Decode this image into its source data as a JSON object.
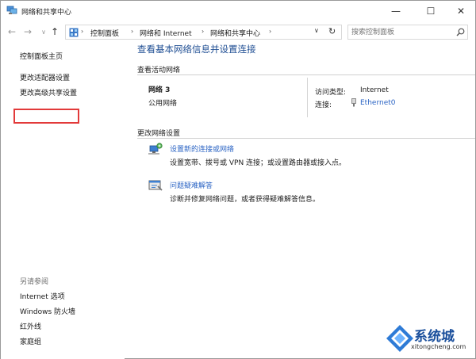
{
  "window": {
    "title": "网络和共享中心",
    "controls": {
      "minimize": "—",
      "maximize": "☐",
      "close": "✕"
    }
  },
  "navbar": {
    "back": "←",
    "forward": "→",
    "recent": "∨",
    "up": "↑",
    "breadcrumb": [
      "控制面板",
      "网络和 Internet",
      "网络和共享中心"
    ],
    "separator": "›",
    "dropdown": "∨",
    "refresh": "↻",
    "search_placeholder": "搜索控制面板"
  },
  "sidebar": {
    "items": [
      {
        "label": "控制面板主页"
      },
      {
        "label": "更改适配器设置"
      },
      {
        "label": "更改高级共享设置"
      }
    ],
    "see_also_title": "另请参阅",
    "see_also": [
      {
        "label": "Internet 选项"
      },
      {
        "label": "Windows 防火墙"
      },
      {
        "label": "红外线"
      },
      {
        "label": "家庭组"
      }
    ],
    "highlight_color": "#e23a3a"
  },
  "main": {
    "heading": "查看基本网络信息并设置连接",
    "active_networks_label": "查看活动网络",
    "network": {
      "name": "网络  3",
      "category": "公用网络",
      "access_type_label": "访问类型:",
      "access_type_value": "Internet",
      "connection_label": "连接:",
      "connection_value": "Ethernet0"
    },
    "change_settings_label": "更改网络设置",
    "tasks": [
      {
        "icon": "network-setup-icon",
        "title": "设置新的连接或网络",
        "desc": "设置宽带、拨号或 VPN 连接；或设置路由器或接入点。"
      },
      {
        "icon": "troubleshoot-icon",
        "title": "问题疑难解答",
        "desc": "诊断并修复网络问题，或者获得疑难解答信息。"
      }
    ],
    "heading_color": "#1f4e93",
    "link_color": "#2b64c4"
  },
  "watermark": {
    "name": "系统城",
    "url": "xitongcheng.com"
  }
}
